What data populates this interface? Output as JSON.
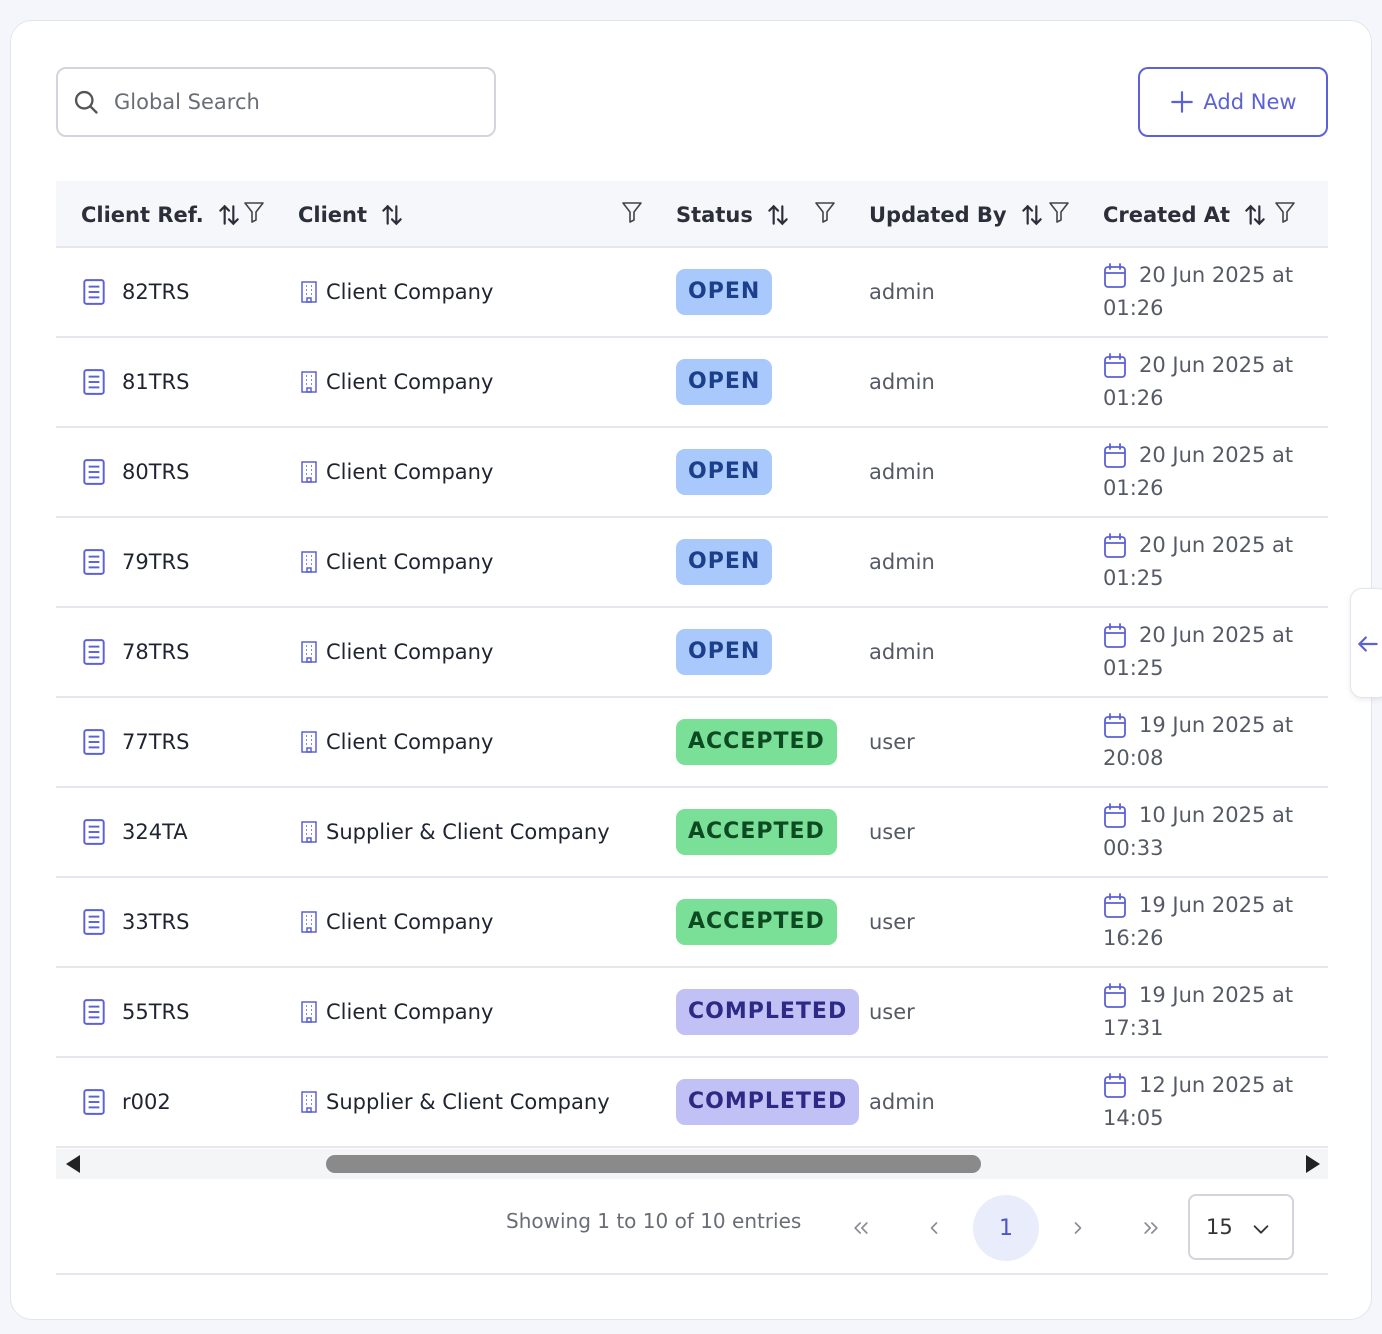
{
  "search": {
    "placeholder": "Global Search"
  },
  "toolbar": {
    "add_new_label": "Add New"
  },
  "columns": [
    {
      "label": "Client Ref."
    },
    {
      "label": "Client"
    },
    {
      "label": "Status"
    },
    {
      "label": "Updated By"
    },
    {
      "label": "Created At"
    }
  ],
  "rows": [
    {
      "ref": "82TRS",
      "client": "Client Company",
      "status": "OPEN",
      "status_type": "open",
      "updated_by": "admin",
      "created_date": "20 Jun 2025 at",
      "created_time": "01:26"
    },
    {
      "ref": "81TRS",
      "client": "Client Company",
      "status": "OPEN",
      "status_type": "open",
      "updated_by": "admin",
      "created_date": "20 Jun 2025 at",
      "created_time": "01:26"
    },
    {
      "ref": "80TRS",
      "client": "Client Company",
      "status": "OPEN",
      "status_type": "open",
      "updated_by": "admin",
      "created_date": "20 Jun 2025 at",
      "created_time": "01:26"
    },
    {
      "ref": "79TRS",
      "client": "Client Company",
      "status": "OPEN",
      "status_type": "open",
      "updated_by": "admin",
      "created_date": "20 Jun 2025 at",
      "created_time": "01:25"
    },
    {
      "ref": "78TRS",
      "client": "Client Company",
      "status": "OPEN",
      "status_type": "open",
      "updated_by": "admin",
      "created_date": "20 Jun 2025 at",
      "created_time": "01:25"
    },
    {
      "ref": "77TRS",
      "client": "Client Company",
      "status": "ACCEPTED",
      "status_type": "accepted",
      "updated_by": "user",
      "created_date": "19 Jun 2025 at",
      "created_time": "20:08"
    },
    {
      "ref": "324TA",
      "client": "Supplier & Client Company",
      "status": "ACCEPTED",
      "status_type": "accepted",
      "updated_by": "user",
      "created_date": "10 Jun 2025 at",
      "created_time": "00:33"
    },
    {
      "ref": "33TRS",
      "client": "Client Company",
      "status": "ACCEPTED",
      "status_type": "accepted",
      "updated_by": "user",
      "created_date": "19 Jun 2025 at",
      "created_time": "16:26"
    },
    {
      "ref": "55TRS",
      "client": "Client Company",
      "status": "COMPLETED",
      "status_type": "completed",
      "updated_by": "user",
      "created_date": "19 Jun 2025 at",
      "created_time": "17:31"
    },
    {
      "ref": "r002",
      "client": "Supplier & Client Company",
      "status": "COMPLETED",
      "status_type": "completed",
      "updated_by": "admin",
      "created_date": "12 Jun 2025 at",
      "created_time": "14:05"
    }
  ],
  "pagination": {
    "summary": "Showing 1 to 10 of 10 entries",
    "current_page": "1",
    "per_page": "15"
  },
  "colors": {
    "accent": "#5b61d6",
    "open_bg": "#a9c8fb",
    "accepted_bg": "#7adf97",
    "completed_bg": "#c2c1f6"
  },
  "icons": {
    "search": "search-icon",
    "add": "plus-icon",
    "sort": "sort-icon",
    "filter": "filter-icon",
    "ref": "document-icon",
    "client": "building-icon",
    "created": "calendar-icon"
  }
}
